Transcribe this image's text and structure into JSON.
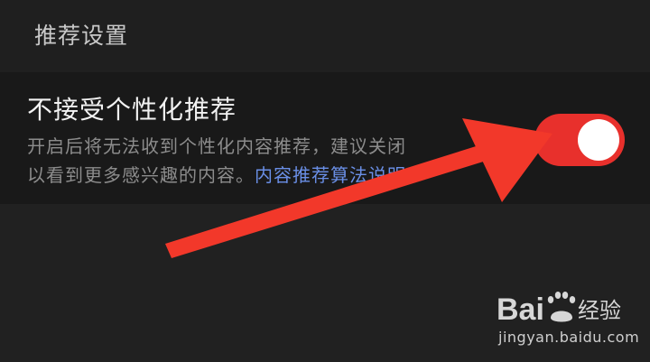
{
  "header": {
    "title": "推荐设置"
  },
  "setting": {
    "title": "不接受个性化推荐",
    "description_line1": "开启后将无法收到个性化内容推荐，建议关闭",
    "description_line2": "以看到更多感兴趣的内容。",
    "link_text": "内容推荐算法说明",
    "toggle_state": "on"
  },
  "watermark": {
    "logo_text": "Bai",
    "logo_suffix": "经验",
    "url": "jingyan.baidu.com"
  },
  "colors": {
    "toggle_on": "#e8302c",
    "link": "#6a8fe6",
    "annotation_arrow": "#f2382a"
  },
  "icons": {
    "annotation": "arrow-pointer-icon",
    "watermark": "baidu-paw-icon"
  }
}
